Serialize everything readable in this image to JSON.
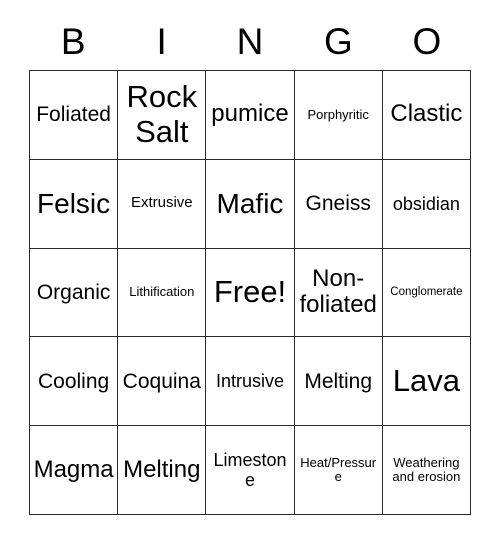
{
  "card": {
    "title": "BINGO",
    "header_letters": [
      "B",
      "I",
      "N",
      "G",
      "O"
    ],
    "border_color": "#2b2b2b",
    "background_color": "#ffffff",
    "text_color": "#000000",
    "grid_size": "5x5",
    "free_space": "Free!"
  },
  "grid": {
    "rows": [
      [
        {
          "label": "Foliated",
          "size": "md"
        },
        {
          "label": "Rock Salt",
          "size": "xxl"
        },
        {
          "label": "pumice",
          "size": "lg"
        },
        {
          "label": "Porphyritic",
          "size": "xxs"
        },
        {
          "label": "Clastic",
          "size": "lg"
        }
      ],
      [
        {
          "label": "Felsic",
          "size": "xl"
        },
        {
          "label": "Extrusive",
          "size": "xs"
        },
        {
          "label": "Mafic",
          "size": "xl"
        },
        {
          "label": "Gneiss",
          "size": "md"
        },
        {
          "label": "obsidian",
          "size": "sm"
        }
      ],
      [
        {
          "label": "Organic",
          "size": "md"
        },
        {
          "label": "Lithification",
          "size": "xxs"
        },
        {
          "label": "Free!",
          "size": "xxl"
        },
        {
          "label": "Non-foliated",
          "size": "lg"
        },
        {
          "label": "Conglomerate",
          "size": "tiny"
        }
      ],
      [
        {
          "label": "Cooling",
          "size": "md"
        },
        {
          "label": "Coquina",
          "size": "md"
        },
        {
          "label": "Intrusive",
          "size": "sm"
        },
        {
          "label": "Melting",
          "size": "md"
        },
        {
          "label": "Lava",
          "size": "xxl"
        }
      ],
      [
        {
          "label": "Magma",
          "size": "lg"
        },
        {
          "label": "Melting",
          "size": "lg"
        },
        {
          "label": "Limestone",
          "size": "sm"
        },
        {
          "label": "Heat/Pressure",
          "size": "xxs"
        },
        {
          "label": "Weathering and erosion",
          "size": "xxs"
        }
      ]
    ]
  }
}
